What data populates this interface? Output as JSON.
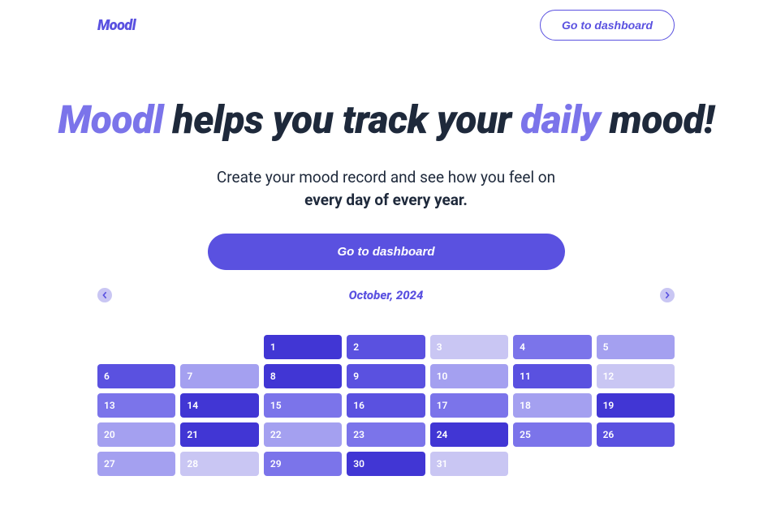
{
  "header": {
    "logo": "Moodl",
    "dashboard_btn": "Go to dashboard"
  },
  "hero": {
    "title_accent1": "Moodl",
    "title_mid1": " helps you track your ",
    "title_accent2": "daily",
    "title_mid2": " mood!",
    "sub_line1": "Create your mood record and see how you feel on",
    "sub_line2": "every day of every year.",
    "cta": "Go to dashboard"
  },
  "calendar": {
    "title": "October, 2024",
    "offset": 2,
    "days": [
      {
        "n": 1,
        "m": 1
      },
      {
        "n": 2,
        "m": 2
      },
      {
        "n": 3,
        "m": 5
      },
      {
        "n": 4,
        "m": 3
      },
      {
        "n": 5,
        "m": 4
      },
      {
        "n": 6,
        "m": 2
      },
      {
        "n": 7,
        "m": 4
      },
      {
        "n": 8,
        "m": 1
      },
      {
        "n": 9,
        "m": 2
      },
      {
        "n": 10,
        "m": 4
      },
      {
        "n": 11,
        "m": 2
      },
      {
        "n": 12,
        "m": 5
      },
      {
        "n": 13,
        "m": 3
      },
      {
        "n": 14,
        "m": 1
      },
      {
        "n": 15,
        "m": 3
      },
      {
        "n": 16,
        "m": 2
      },
      {
        "n": 17,
        "m": 3
      },
      {
        "n": 18,
        "m": 4
      },
      {
        "n": 19,
        "m": 1
      },
      {
        "n": 20,
        "m": 4
      },
      {
        "n": 21,
        "m": 1
      },
      {
        "n": 22,
        "m": 4
      },
      {
        "n": 23,
        "m": 3
      },
      {
        "n": 24,
        "m": 1
      },
      {
        "n": 25,
        "m": 3
      },
      {
        "n": 26,
        "m": 2
      },
      {
        "n": 27,
        "m": 4
      },
      {
        "n": 28,
        "m": 5
      },
      {
        "n": 29,
        "m": 3
      },
      {
        "n": 30,
        "m": 1
      },
      {
        "n": 31,
        "m": 5
      }
    ]
  }
}
